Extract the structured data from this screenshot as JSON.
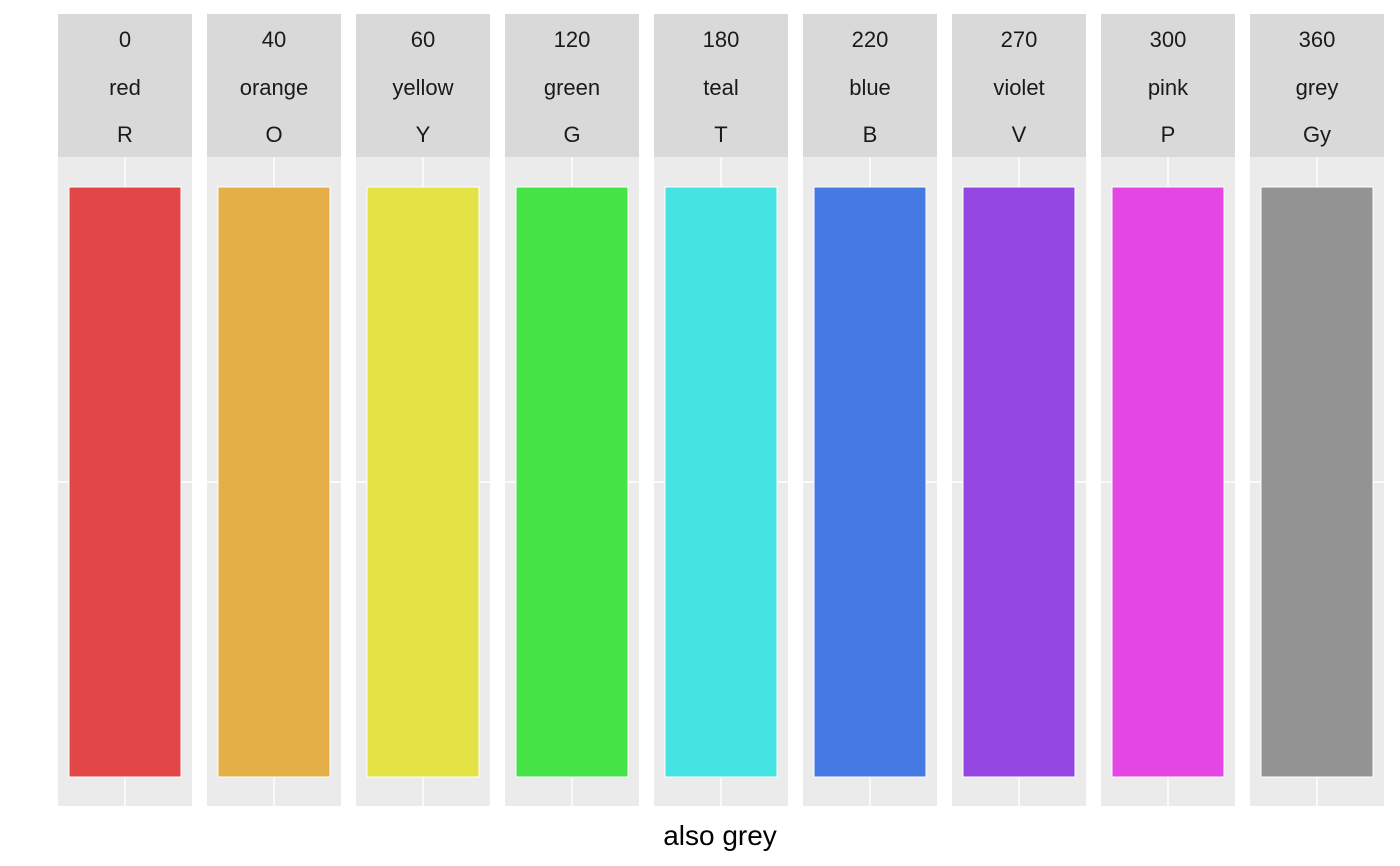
{
  "chart_data": {
    "type": "bar",
    "xlabel": "also grey",
    "ylabel": "",
    "ylim": [
      0,
      1
    ],
    "grid": true,
    "panels": [
      {
        "hue": "0",
        "name": "red",
        "code": "R",
        "value": 1,
        "color": "#e34646"
      },
      {
        "hue": "40",
        "name": "orange",
        "code": "O",
        "value": 1,
        "color": "#e3af46"
      },
      {
        "hue": "60",
        "name": "yellow",
        "code": "Y",
        "value": 1,
        "color": "#e3e346"
      },
      {
        "hue": "120",
        "name": "green",
        "code": "G",
        "value": 1,
        "color": "#46e346"
      },
      {
        "hue": "180",
        "name": "teal",
        "code": "T",
        "value": 1,
        "color": "#46e3e3"
      },
      {
        "hue": "220",
        "name": "blue",
        "code": "B",
        "value": 1,
        "color": "#467ae3"
      },
      {
        "hue": "270",
        "name": "violet",
        "code": "V",
        "value": 1,
        "color": "#9446e3"
      },
      {
        "hue": "300",
        "name": "pink",
        "code": "P",
        "value": 1,
        "color": "#e346e3"
      },
      {
        "hue": "360",
        "name": "grey",
        "code": "Gy",
        "value": 1,
        "color": "#939393"
      }
    ],
    "strip_color": "#d9d9d9",
    "panel_color": "#ebebeb",
    "grid_color": "#ffffff"
  }
}
